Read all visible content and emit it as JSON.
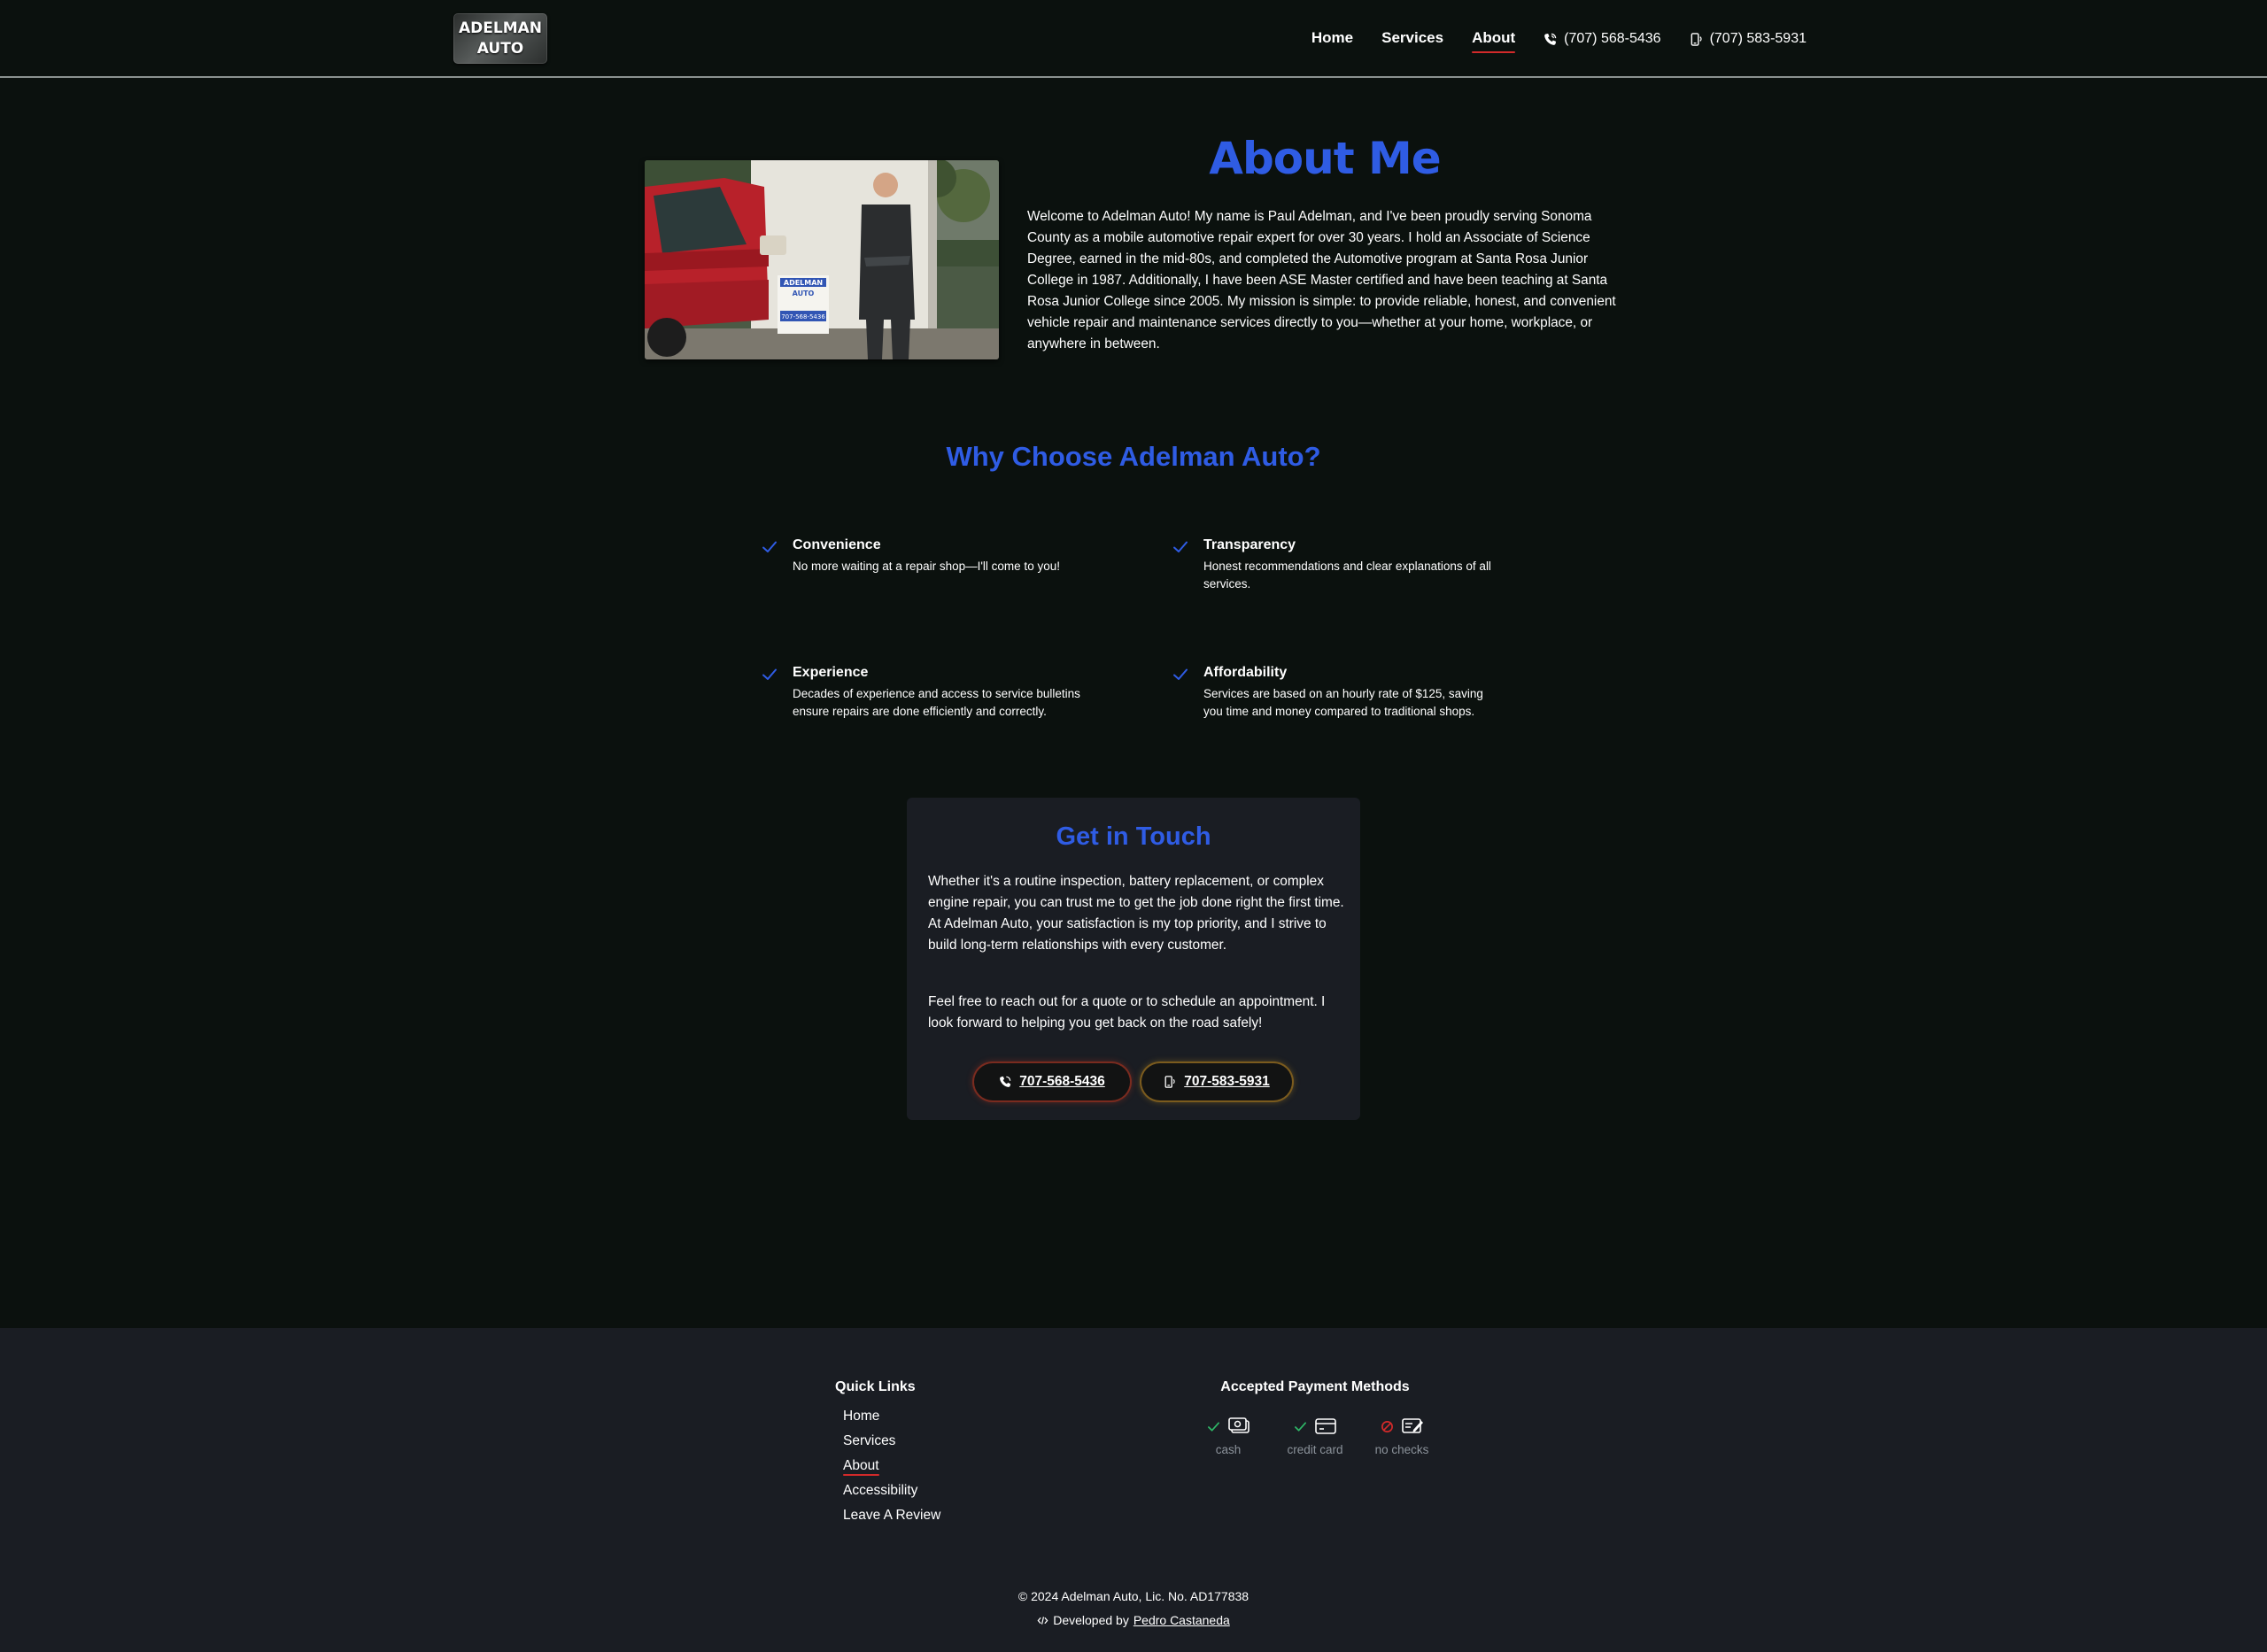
{
  "brand": {
    "line1": "ADELMAN",
    "line2": "AUTO"
  },
  "nav": {
    "items": [
      {
        "label": "Home"
      },
      {
        "label": "Services"
      },
      {
        "label": "About"
      }
    ],
    "phone_landline": "(707) 568-5436",
    "phone_mobile": "(707) 583-5931"
  },
  "about": {
    "title": "About Me",
    "text": "Welcome to Adelman Auto! My name is Paul Adelman, and I've been proudly serving Sonoma County as a mobile automotive repair expert for over 30 years. I hold an Associate of Science Degree, earned in the mid-80s, and completed the Automotive program at Santa Rosa Junior College in 1987. Additionally, I have been ASE Master certified and have been teaching at Santa Rosa Junior College since 2005. My mission is simple: to provide reliable, honest, and convenient vehicle repair and maintenance services directly to you—whether at your home, workplace, or anywhere in between.",
    "photo_sign": {
      "line1": "ADELMAN",
      "line2": "AUTO",
      "phone": "707-568-5436"
    }
  },
  "why": {
    "title": "Why Choose Adelman Auto?",
    "features": [
      {
        "title": "Convenience",
        "desc": "No more waiting at a repair shop—I'll come to you!"
      },
      {
        "title": "Transparency",
        "desc": "Honest recommendations and clear explanations of all services."
      },
      {
        "title": "Experience",
        "desc": "Decades of experience and access to service bulletins ensure repairs are done efficiently and correctly."
      },
      {
        "title": "Affordability",
        "desc": "Services are based on an hourly rate of $125, saving you time and money compared to traditional shops."
      }
    ]
  },
  "contact": {
    "title": "Get in Touch",
    "p1": "Whether it's a routine inspection, battery replacement, or complex engine repair, you can trust me to get the job done right the first time. At Adelman Auto, your satisfaction is my top priority, and I strive to build long-term relationships with every customer.",
    "p2": "Feel free to reach out for a quote or to schedule an appointment. I look forward to helping you get back on the road safely!",
    "btn_landline": "707-568-5436",
    "btn_mobile": "707-583-5931"
  },
  "footer": {
    "quick_links_title": "Quick Links",
    "links": [
      {
        "label": "Home"
      },
      {
        "label": "Services"
      },
      {
        "label": "About"
      },
      {
        "label": "Accessibility"
      },
      {
        "label": "Leave A Review"
      }
    ],
    "payment_title": "Accepted Payment Methods",
    "payments": [
      {
        "label": "cash",
        "accepted": true,
        "icon": "cash-icon"
      },
      {
        "label": "credit card",
        "accepted": true,
        "icon": "credit-card-icon"
      },
      {
        "label": "no checks",
        "accepted": false,
        "icon": "check-icon"
      }
    ],
    "copyright": "© 2024 Adelman Auto, Lic. No. AD177838",
    "developed_by": "Developed by",
    "developer": "Pedro Castaneda"
  },
  "colors": {
    "background": "#0b110e",
    "accent_blue": "#2f5ce4",
    "active_underline": "#d22a2a",
    "footer_bg": "#1a1d23",
    "accepted_green": "#2fb868",
    "rejected_red": "#d22a2a"
  }
}
